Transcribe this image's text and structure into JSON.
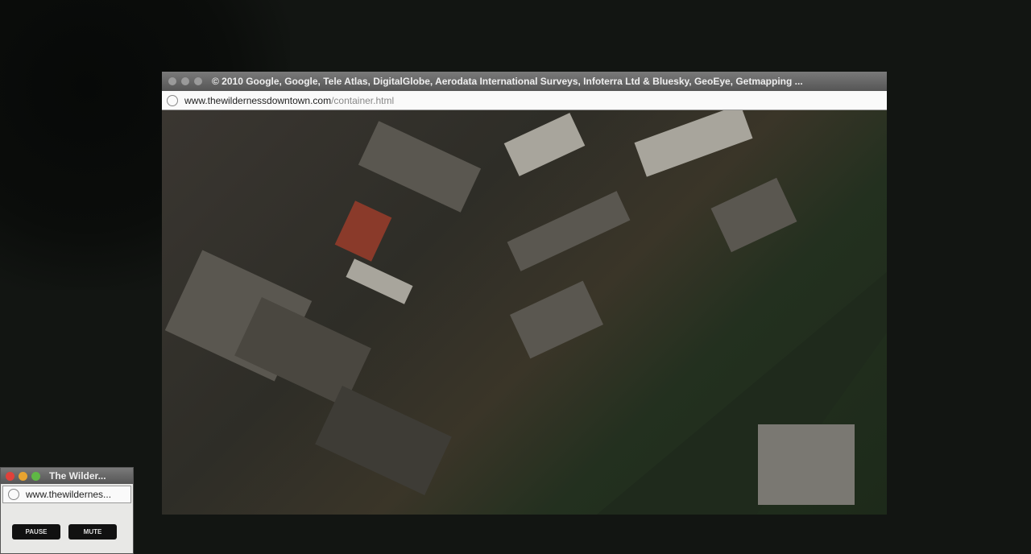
{
  "main_window": {
    "title": "© 2010 Google, Google, Tele Atlas, DigitalGlobe, Aerodata International Surveys, Infoterra Ltd & Bluesky, GeoEye, Getmapping ...",
    "url_domain": "www.thewildernessdowntown.com",
    "url_path": "/container.html"
  },
  "mini_window": {
    "title": "The Wilder...",
    "url": "www.thewildernes...",
    "pause_label": "PAUSE",
    "mute_label": "MUTE"
  },
  "colors": {
    "close": "#e0413a",
    "minimize": "#e8a430",
    "zoom": "#5fb845"
  }
}
